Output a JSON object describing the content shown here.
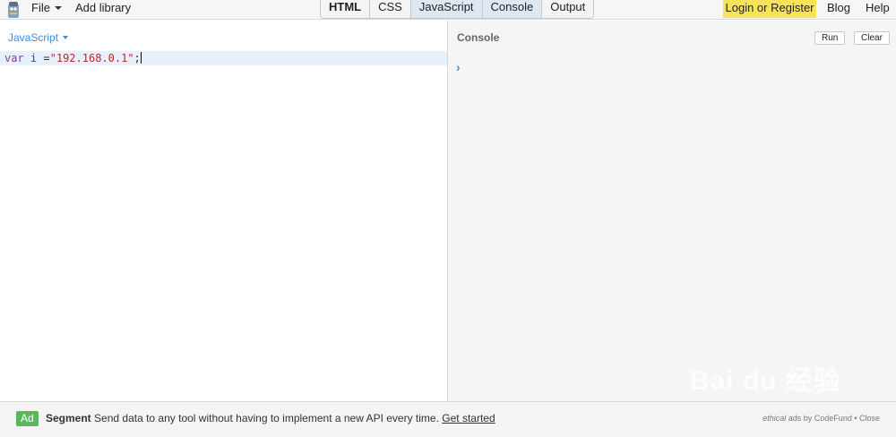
{
  "topbar": {
    "file_label": "File",
    "add_library_label": "Add library",
    "tabs": [
      {
        "label": "HTML",
        "active": false,
        "bold": true
      },
      {
        "label": "CSS",
        "active": false,
        "bold": false
      },
      {
        "label": "JavaScript",
        "active": true,
        "bold": false
      },
      {
        "label": "Console",
        "active": true,
        "bold": false
      },
      {
        "label": "Output",
        "active": false,
        "bold": false
      }
    ],
    "login_label": "Login or Register",
    "blog_label": "Blog",
    "help_label": "Help"
  },
  "editor": {
    "language": "JavaScript",
    "code": {
      "keyword": "var",
      "identifier": "i",
      "operator": "=",
      "string": "\"192.168.0.1\"",
      "terminator": ";"
    }
  },
  "console": {
    "title": "Console",
    "run_label": "Run",
    "clear_label": "Clear",
    "prompt": "›"
  },
  "ad": {
    "badge": "Ad",
    "brand": "Segment",
    "text": "Send data to any tool without having to implement a new API every time.",
    "link": "Get started",
    "credit_ethical": "ethical",
    "credit_rest": "ads by CodeFund",
    "close": "Close"
  },
  "watermark": "Bai du 经验",
  "colors": {
    "accent_blue": "#3d8ee0",
    "login_yellow": "#f7e359",
    "ad_green": "#5bb75b"
  }
}
